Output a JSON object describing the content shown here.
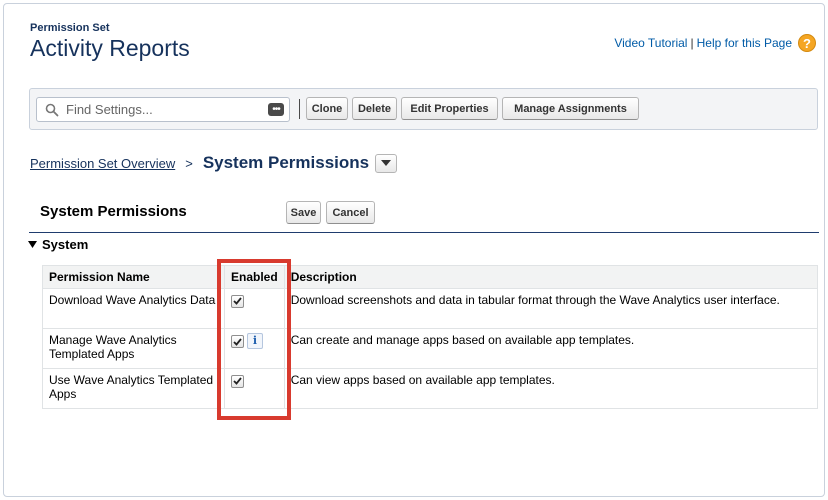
{
  "header": {
    "eyebrow": "Permission Set",
    "title": "Activity Reports"
  },
  "help": {
    "video_tutorial": "Video Tutorial",
    "separator": "|",
    "help_for_page": "Help for this Page",
    "help_icon_glyph": "?"
  },
  "toolbar": {
    "search_placeholder": "Find Settings...",
    "more_icon_glyph": "•••",
    "buttons": {
      "clone": "Clone",
      "delete": "Delete",
      "edit_properties": "Edit Properties",
      "manage_assignments": "Manage Assignments"
    }
  },
  "breadcrumb": {
    "link": "Permission Set Overview",
    "separator": ">",
    "current": "System Permissions"
  },
  "section": {
    "title": "System Permissions",
    "save": "Save",
    "cancel": "Cancel"
  },
  "group": {
    "title": "System"
  },
  "table": {
    "columns": [
      "Permission Name",
      "Enabled",
      "Description"
    ],
    "rows": [
      {
        "name": "Download Wave Analytics Data",
        "enabled": true,
        "has_info": false,
        "description": "Download screenshots and data in tabular format through the Wave Analytics user interface."
      },
      {
        "name": "Manage Wave Analytics Templated Apps",
        "enabled": true,
        "has_info": true,
        "info_glyph": "i",
        "description": "Can create and manage apps based on available app templates."
      },
      {
        "name": "Use Wave Analytics Templated Apps",
        "enabled": true,
        "has_info": false,
        "description": "Can view apps based on available app templates."
      }
    ]
  },
  "colors": {
    "title_navy": "#16325c",
    "link_blue": "#015ba7",
    "help_orange": "#f5a623",
    "highlight_red": "#d83a2e",
    "header_rule": "#1f3c6e"
  }
}
